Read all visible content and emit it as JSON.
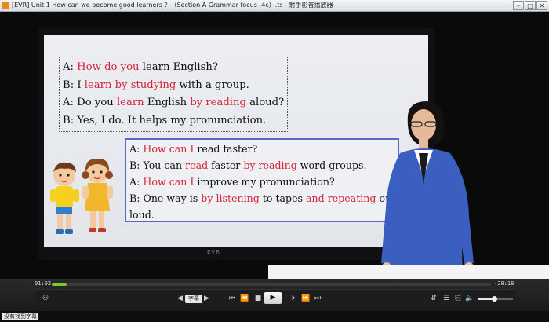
{
  "window": {
    "title": "[EVR] Unit 1 How can we become good learners ？（Section A Grammar focus -4c）.ts - 射手影音播放器",
    "buttons": [
      "–",
      "□",
      "✕"
    ]
  },
  "slide": {
    "box1": [
      [
        {
          "t": "A: ",
          "h": false
        },
        {
          "t": "How do you",
          "h": true
        },
        {
          "t": " learn English?",
          "h": false
        }
      ],
      [
        {
          "t": "B: I ",
          "h": false
        },
        {
          "t": "learn by studying",
          "h": true
        },
        {
          "t": " with a group.",
          "h": false
        }
      ],
      [
        {
          "t": "A: Do you ",
          "h": false
        },
        {
          "t": "learn",
          "h": true
        },
        {
          "t": " English ",
          "h": false
        },
        {
          "t": "by reading",
          "h": true
        },
        {
          "t": " aloud?",
          "h": false
        }
      ],
      [
        {
          "t": "B: Yes, I do. It helps my pronunciation.",
          "h": false
        }
      ]
    ],
    "box2": [
      [
        {
          "t": "A: ",
          "h": false
        },
        {
          "t": "How can I",
          "h": true
        },
        {
          "t": " read faster?",
          "h": false
        }
      ],
      [
        {
          "t": "B: You can ",
          "h": false
        },
        {
          "t": "read",
          "h": true
        },
        {
          "t": " faster ",
          "h": false
        },
        {
          "t": "by reading",
          "h": true
        },
        {
          "t": " word groups.",
          "h": false
        }
      ],
      [
        {
          "t": "A: ",
          "h": false
        },
        {
          "t": "How can I",
          "h": true
        },
        {
          "t": " improve my pronunciation?",
          "h": false
        }
      ],
      [
        {
          "t": "B: One way is ",
          "h": false
        },
        {
          "t": "by listening",
          "h": true
        },
        {
          "t": " to tapes ",
          "h": false
        },
        {
          "t": "and repeating",
          "h": true
        },
        {
          "t": " out",
          "h": false
        }
      ],
      [
        {
          "t": "loud.",
          "h": false
        }
      ]
    ],
    "highlight_color": "#d4263a",
    "screen_logo": "EVR"
  },
  "player": {
    "elapsed": "01:02",
    "remaining": "-28:18",
    "progress": 0.034,
    "volume": 0.45,
    "subtitle_label": "字幕",
    "status_text": "没有找到字幕",
    "accent": "#7cc43a"
  }
}
